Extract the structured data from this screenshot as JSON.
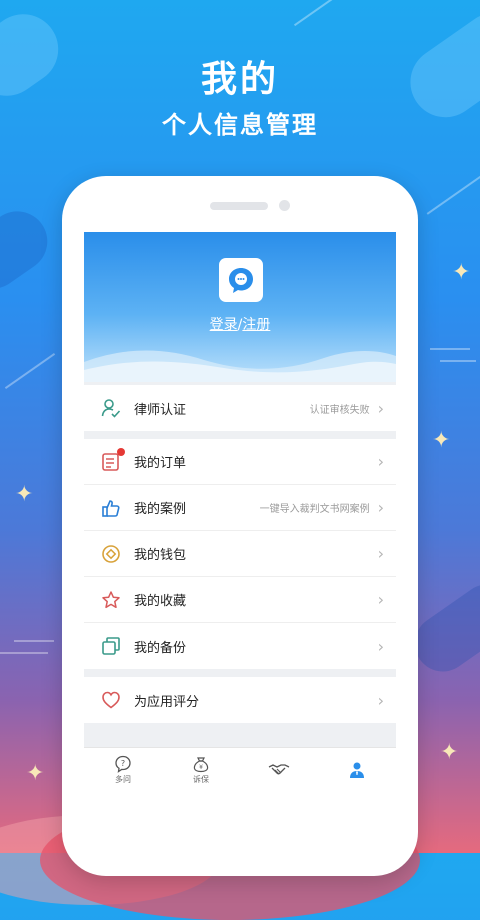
{
  "hero": {
    "title": "我的",
    "subtitle": "个人信息管理"
  },
  "colors": {
    "accent": "#2a8eea",
    "badge": "#e53935"
  },
  "header": {
    "logo_icon": "chat-bubble-icon",
    "login_label": "登录",
    "separator": "/",
    "register_label": "注册"
  },
  "menu": {
    "lawyer": {
      "label": "律师认证",
      "hint": "认证审核失败",
      "icon": "person-check-icon"
    },
    "orders": {
      "label": "我的订单",
      "icon": "order-list-icon"
    },
    "cases": {
      "label": "我的案例",
      "hint": "一键导入裁判文书网案例",
      "icon": "thumbs-up-icon"
    },
    "wallet": {
      "label": "我的钱包",
      "icon": "wallet-icon"
    },
    "favorites": {
      "label": "我的收藏",
      "icon": "star-icon"
    },
    "backup": {
      "label": "我的备份",
      "icon": "backup-icon"
    },
    "rate": {
      "label": "为应用评分",
      "icon": "heart-icon"
    }
  },
  "tabs": [
    {
      "label": "多问",
      "icon": "question-icon"
    },
    {
      "label": "诉保",
      "icon": "money-bag-icon"
    },
    {
      "label": "",
      "icon": "handshake-icon"
    },
    {
      "label": "",
      "icon": "user-icon"
    }
  ]
}
